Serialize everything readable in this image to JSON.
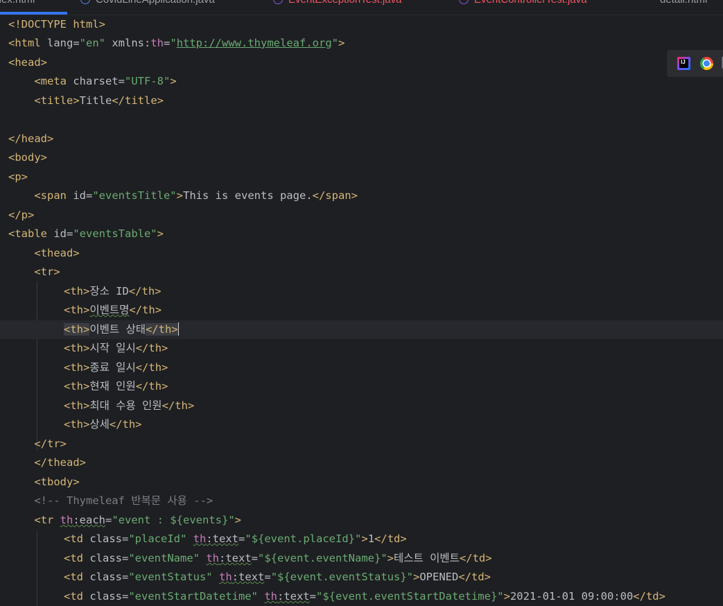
{
  "tabs": [
    {
      "label": "index.html"
    },
    {
      "label": "CovidLineApplication.java"
    },
    {
      "label": "EventExceptionTest.java"
    },
    {
      "label": "EventControllerTest.java"
    },
    {
      "label": "detail.html"
    }
  ],
  "code": {
    "l1": "<!DOCTYPE html>",
    "l2_open": "<html",
    "l2_lang": " lang=",
    "l2_lang_val": "\"en\"",
    "l2_xmlns": " xmlns:",
    "l2_ns": "th",
    "l2_eq": "=",
    "l2_q1": "\"",
    "l2_url": "http://www.thymeleaf.org",
    "l2_q2": "\"",
    "l2_close": ">",
    "l3": "<head>",
    "l4_open": "    <meta",
    "l4_attr": " charset=",
    "l4_val": "\"UTF-8\"",
    "l4_close": ">",
    "l5_open": "    <title>",
    "l5_text": "Title",
    "l5_close": "</title>",
    "l7": "</head>",
    "l8": "<body>",
    "l9": "<p>",
    "l10_open": "    <span",
    "l10_attr": " id=",
    "l10_val": "\"eventsTitle\"",
    "l10_gt": ">",
    "l10_text": "This is events page.",
    "l10_close": "</span>",
    "l11": "</p>",
    "l12_open": "<table",
    "l12_attr": " id=",
    "l12_val": "\"eventsTable\"",
    "l12_close": ">",
    "l13": "    <thead>",
    "l14": "    <tr>",
    "th_open": "<th>",
    "th_close": "</th>",
    "th1": "장소 ID",
    "th2": "이벤트명",
    "th3": "이벤트 상태",
    "th4": "시작 일시",
    "th5": "종료 일시",
    "th6": "현재 인원",
    "th7": "최대 수용 인원",
    "th8": "상세",
    "l23": "    </tr>",
    "l24": "    </thead>",
    "l25": "    <tbody>",
    "l26": "    <!-- Thymeleaf 반복문 사용 -->",
    "l27_open": "    <tr",
    "l27_ns": "th",
    "l27_each": ":each",
    "l27_eq": "=",
    "l27_val": "\"event : ${events}\"",
    "l27_close": ">",
    "td_open": "<td",
    "td_class_attr": " class=",
    "th_text_ns": "th",
    "th_text_attr": ":text",
    "eq": "=",
    "gt": ">",
    "td_close": "</td>",
    "r1_class": "\"placeId\"",
    "r1_expr": "\"${event.placeId}\"",
    "r1_text": "1",
    "r2_class": "\"eventName\"",
    "r2_expr": "\"${event.eventName}\"",
    "r2_text": "테스트 이벤트",
    "r3_class": "\"eventStatus\"",
    "r3_expr": "\"${event.eventStatus}\"",
    "r3_text": "OPENED",
    "r4_class": "\"eventStartDatetime\"",
    "r4_expr": "\"${event.eventStartDatetime}\"",
    "r4_text": "2021-01-01 09:00:00"
  },
  "browser_popup": {
    "icons": [
      "intellij-icon",
      "chrome-icon"
    ],
    "ij_letters": "IJ"
  },
  "colors": {
    "background": "#1e1f22",
    "tag": "#d5b778",
    "attr_value": "#6aab73",
    "namespace": "#c77dbb",
    "comment": "#7a7e85",
    "text": "#bcbec4",
    "active_tab_underline": "#3574f0",
    "error_tab": "#f75464"
  }
}
